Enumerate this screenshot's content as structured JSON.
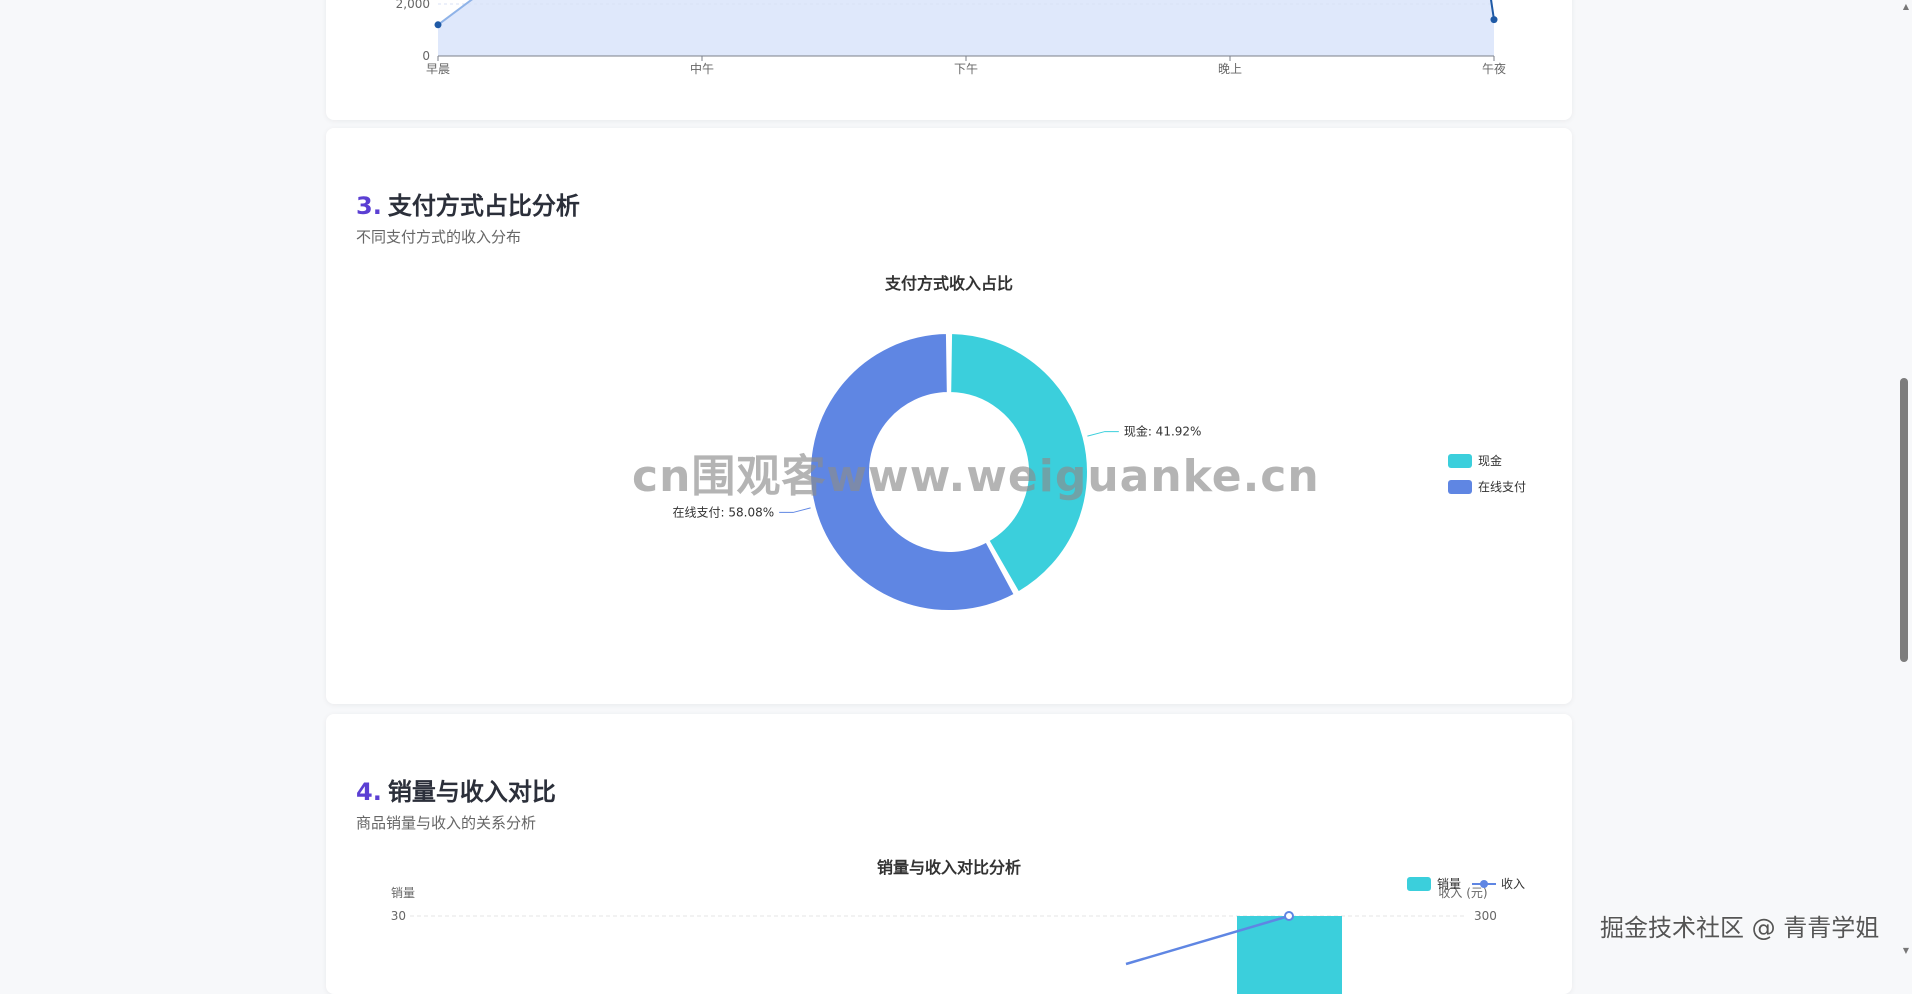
{
  "top_chart": {
    "chart_data": {
      "type": "area",
      "categories": [
        "早晨",
        "中午",
        "下午",
        "晚上",
        "午夜"
      ],
      "y_ticks": [
        "0",
        "2,000"
      ],
      "visible_points": [
        {
          "x": "早晨",
          "y": 1200
        },
        {
          "x": "午夜",
          "y": 1400
        }
      ],
      "line_color": "#1f5aa6",
      "fill_color": "#dfe8fb"
    }
  },
  "section3": {
    "number": "3.",
    "title": "支付方式占比分析",
    "subtitle": "不同支付方式的收入分布",
    "chart_data": {
      "type": "pie",
      "title": "支付方式收入占比",
      "slices": [
        {
          "name": "现金",
          "value": 41.92,
          "label": "现金: 41.92%",
          "color": "#3bcfdc"
        },
        {
          "name": "在线支付",
          "value": 58.08,
          "label": "在线支付: 58.08%",
          "color": "#5f86e3"
        }
      ],
      "legend_position": "right"
    }
  },
  "section4": {
    "number": "4.",
    "title": "销量与收入对比",
    "subtitle": "商品销量与收入的关系分析",
    "chart_data": {
      "type": "bar",
      "title": "销量与收入对比分析",
      "ylabel": "销量",
      "ylabel_right": "收入 (元)",
      "y_ticks_left": [
        "30"
      ],
      "y_ticks_right": [
        "300"
      ],
      "series": [
        {
          "name": "销量",
          "type": "bar",
          "color": "#3bcfdc"
        },
        {
          "name": "收入",
          "type": "line",
          "color": "#5f86e3"
        }
      ]
    }
  },
  "watermarks": {
    "center": "cn围观客www.weiguanke.cn",
    "corner": "掘金技术社区 @ 青青学姐"
  }
}
